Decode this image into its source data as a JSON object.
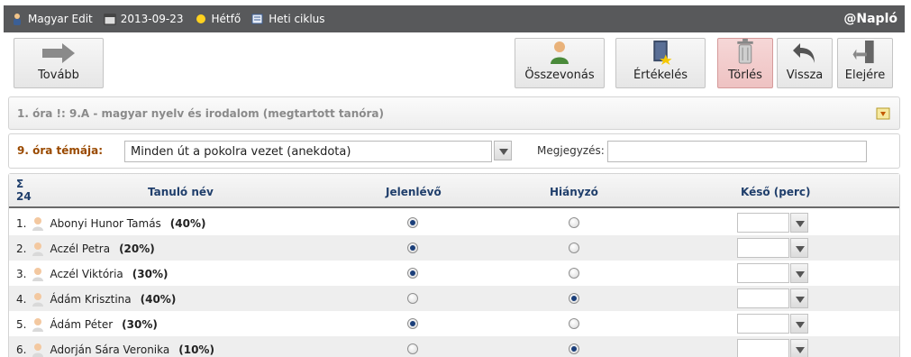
{
  "topbar": {
    "user": "Magyar Edit",
    "date": "2013-09-23",
    "day": "Hétfő",
    "cycle": "Heti ciklus",
    "brand": "@Napló"
  },
  "toolbar": {
    "next_label": "Tovább",
    "summary_label": "Összevonás",
    "grading_label": "Értékelés",
    "delete_label": "Törlés",
    "back_label": "Vissza",
    "start_label": "Elejére"
  },
  "lesson": {
    "title": "1. óra !: 9.A - magyar nyelv és irodalom (megtartott tanóra)"
  },
  "topic": {
    "label": "9. óra témája:",
    "value": "Minden út a pokolra vezet (anekdota)",
    "note_label": "Megjegyzés:",
    "note_value": ""
  },
  "table": {
    "sigma": "Σ",
    "count": "24",
    "headers": {
      "name": "Tanuló név",
      "present": "Jelenlévő",
      "absent": "Hiányzó",
      "late": "Késő (perc)"
    },
    "rows": [
      {
        "num": "1.",
        "name": "Abonyi Hunor Tamás",
        "pct": "(40%)",
        "present": true
      },
      {
        "num": "2.",
        "name": "Aczél Petra",
        "pct": "(20%)",
        "present": true
      },
      {
        "num": "3.",
        "name": "Aczél Viktória",
        "pct": "(30%)",
        "present": true
      },
      {
        "num": "4.",
        "name": "Ádám Krisztina",
        "pct": "(40%)",
        "present": false
      },
      {
        "num": "5.",
        "name": "Ádám Péter",
        "pct": "(30%)",
        "present": true
      },
      {
        "num": "6.",
        "name": "Adorján Sára Veronika",
        "pct": "(10%)",
        "present": false
      }
    ]
  },
  "colors": {
    "topbar_bg": "#58595b",
    "header_text": "#1f3e6b",
    "topic_label": "#9a4a00",
    "delete_bg": "#f6d7d7"
  },
  "icons": [
    "user-icon",
    "calendar-icon",
    "sun-icon",
    "cycle-icon",
    "arrow-right-icon",
    "person-icon",
    "grade-book-icon",
    "trash-icon",
    "undo-icon",
    "door-icon",
    "collapse-icon",
    "chevron-down-icon",
    "avatar-icon"
  ]
}
